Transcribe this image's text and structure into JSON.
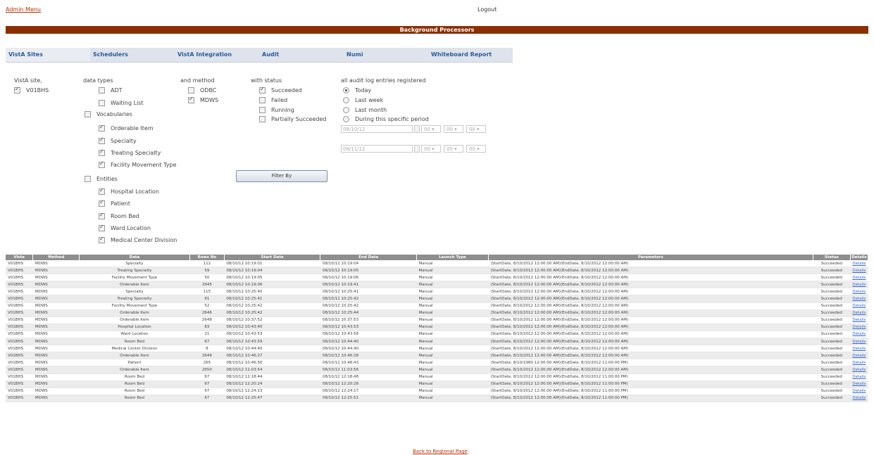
{
  "top": {
    "admin_menu": "Admin Menu",
    "logout": "Logout"
  },
  "banner": {
    "title": "Background Processors"
  },
  "tabs": [
    "VistA Sites",
    "Schedulers",
    "VistA Integration",
    "Audit",
    "Numi",
    "Whiteboard Report"
  ],
  "filters": {
    "site": {
      "heading": "VistA site,",
      "items": [
        {
          "label": "V01BHS",
          "checked": true
        }
      ]
    },
    "data_types": {
      "heading": "data types",
      "adt": "ADT",
      "waiting_list": "Waiting List",
      "vocabularies": "Vocabularies",
      "vocab_items": [
        "Orderable Item",
        "Specialty",
        "Treating Specialty",
        "Facility Movement Type"
      ],
      "entities": "Entities",
      "entity_items": [
        "Hospital Location",
        "Patient",
        "Room Bed",
        "Ward Location",
        "Medical Center Division"
      ]
    },
    "method": {
      "heading": "and method",
      "odbc": "ODBC",
      "mdws": "MDWS"
    },
    "status": {
      "heading": "with status",
      "items": [
        "Succeeded",
        "Failed",
        "Running",
        "Partially Succeeded"
      ]
    },
    "period": {
      "heading": "all audit log entries registered",
      "options": [
        "Today",
        "Last week",
        "Last month",
        "During this specific period"
      ],
      "from_date": "08/10/12",
      "to_date": "08/11/12",
      "time_placeholder": "00"
    },
    "filter_button": "Filter By"
  },
  "table": {
    "headers": [
      "Vista",
      "Method",
      "Data",
      "Rows No",
      "Start Date",
      "End Date",
      "Launch Type",
      "Parameters",
      "Status",
      "Details"
    ],
    "rows": [
      [
        "V01BHS",
        "MDWS",
        "Specialty",
        "112",
        "08/10/12 10:19:01",
        "08/10/12 10:19:04",
        "Manual",
        "(StartDate, 8/10/2012 12:00:00 AM)(EndDate, 8/10/2012 12:00:00 AM)",
        "Succeeded",
        "Details"
      ],
      [
        "V01BHS",
        "MDWS",
        "Treating Specialty",
        "59",
        "08/10/12 10:19:04",
        "08/10/12 10:19:05",
        "Manual",
        "(StartDate, 8/10/2012 12:00:00 AM)(EndDate, 8/10/2012 12:00:00 AM)",
        "Succeeded",
        "Details"
      ],
      [
        "V01BHS",
        "MDWS",
        "Facility Movement Type",
        "50",
        "08/10/12 10:19:05",
        "08/10/12 10:19:06",
        "Manual",
        "(StartDate, 8/10/2012 12:00:00 AM)(EndDate, 8/10/2012 12:00:00 AM)",
        "Succeeded",
        "Details"
      ],
      [
        "V01BHS",
        "MDWS",
        "Orderable Item",
        "2645",
        "08/10/12 10:19:06",
        "08/10/12 10:19:41",
        "Manual",
        "(StartDate, 8/10/2012 12:00:00 AM)(EndDate, 8/10/2012 12:00:00 AM)",
        "Succeeded",
        "Details"
      ],
      [
        "V01BHS",
        "MDWS",
        "Specialty",
        "115",
        "08/10/12 10:25:40",
        "08/10/12 10:25:41",
        "Manual",
        "(StartDate, 8/10/2012 12:00:00 AM)(EndDate, 8/10/2012 12:00:00 AM)",
        "Succeeded",
        "Details"
      ],
      [
        "V01BHS",
        "MDWS",
        "Treating Specialty",
        "61",
        "08/10/12 10:25:41",
        "08/10/12 10:25:42",
        "Manual",
        "(StartDate, 8/10/2012 12:00:00 AM)(EndDate, 8/10/2012 12:00:00 AM)",
        "Succeeded",
        "Details"
      ],
      [
        "V01BHS",
        "MDWS",
        "Facility Movement Type",
        "52",
        "08/10/12 10:25:42",
        "08/10/12 10:25:42",
        "Manual",
        "(StartDate, 8/10/2012 12:00:00 AM)(EndDate, 8/10/2012 12:00:00 AM)",
        "Succeeded",
        "Details"
      ],
      [
        "V01BHS",
        "MDWS",
        "Orderable Item",
        "2646",
        "08/10/12 10:25:42",
        "08/10/12 10:25:44",
        "Manual",
        "(StartDate, 8/10/2012 12:00:00 AM)(EndDate, 8/10/2012 12:00:00 AM)",
        "Succeeded",
        "Details"
      ],
      [
        "V01BHS",
        "MDWS",
        "Orderable Item",
        "2648",
        "08/10/12 10:37:52",
        "08/10/12 10:37:53",
        "Manual",
        "(StartDate, 8/10/2012 12:00:00 AM)(EndDate, 8/10/2012 12:00:00 AM)",
        "Succeeded",
        "Details"
      ],
      [
        "V01BHS",
        "MDWS",
        "Hospital Location",
        "83",
        "08/10/12 10:43:40",
        "08/10/12 10:43:53",
        "Manual",
        "(StartDate, 8/10/2012 12:00:00 AM)(EndDate, 8/10/2012 12:00:00 AM)",
        "Succeeded",
        "Details"
      ],
      [
        "V01BHS",
        "MDWS",
        "Ward Location",
        "21",
        "08/10/12 10:43:53",
        "08/10/12 10:43:58",
        "Manual",
        "(StartDate, 8/10/2012 12:00:00 AM)(EndDate, 8/10/2012 12:00:00 AM)",
        "Succeeded",
        "Details"
      ],
      [
        "V01BHS",
        "MDWS",
        "Room Bed",
        "67",
        "08/10/12 10:43:59",
        "08/10/12 10:44:40",
        "Manual",
        "(StartDate, 8/10/2012 12:00:00 AM)(EndDate, 8/10/2012 12:00:00 AM)",
        "Succeeded",
        "Details"
      ],
      [
        "V01BHS",
        "MDWS",
        "Medical Center Division",
        "8",
        "08/10/12 10:44:40",
        "08/10/12 10:44:40",
        "Manual",
        "(StartDate, 8/10/2012 12:00:00 AM)(EndDate, 8/10/2012 12:00:00 AM)",
        "Succeeded",
        "Details"
      ],
      [
        "V01BHS",
        "MDWS",
        "Orderable Item",
        "2649",
        "08/10/12 10:46:27",
        "08/10/12 10:46:28",
        "Manual",
        "(StartDate, 8/10/2012 12:00:00 AM)(EndDate, 8/10/2012 12:00:00 AM)",
        "Succeeded",
        "Details"
      ],
      [
        "V01BHS",
        "MDWS",
        "Patient",
        "265",
        "08/10/12 10:46:56",
        "08/10/12 10:48:43",
        "Manual",
        "(StartDate, 8/10/1980 12:00:00 AM)(EndDate, 8/10/2012 11:00:00 PM)",
        "Succeeded",
        "Details"
      ],
      [
        "V01BHS",
        "MDWS",
        "Orderable Item",
        "2650",
        "08/10/12 11:03:54",
        "08/10/12 11:03:56",
        "Manual",
        "(StartDate, 8/10/2012 12:00:00 AM)(EndDate, 8/10/2012 12:00:00 AM)",
        "Succeeded",
        "Details"
      ],
      [
        "V01BHS",
        "MDWS",
        "Room Bed",
        "67",
        "08/10/12 12:18:44",
        "08/10/12 12:18:48",
        "Manual",
        "(StartDate, 8/10/2012 12:00:00 AM)(EndDate, 8/10/2012 11:00:00 PM)",
        "Succeeded",
        "Details"
      ],
      [
        "V01BHS",
        "MDWS",
        "Room Bed",
        "67",
        "08/10/12 12:20:24",
        "08/10/12 12:20:28",
        "Manual",
        "(StartDate, 8/10/2012 12:00:00 AM)(EndDate, 8/10/2012 11:00:00 PM)",
        "Succeeded",
        "Details"
      ],
      [
        "V01BHS",
        "MDWS",
        "Room Bed",
        "67",
        "08/10/12 12:24:13",
        "08/10/12 12:24:17",
        "Manual",
        "(StartDate, 8/10/2012 12:00:00 AM)(EndDate, 8/10/2012 11:00:00 PM)",
        "Succeeded",
        "Details"
      ],
      [
        "V01BHS",
        "MDWS",
        "Room Bed",
        "67",
        "08/10/12 12:25:47",
        "08/10/12 12:25:51",
        "Manual",
        "(StartDate, 8/10/2012 12:00:00 AM)(EndDate, 8/10/2012 11:00:00 PM)",
        "Succeeded",
        "Details"
      ]
    ]
  },
  "footer": {
    "back_link": "Back to Regional Page",
    "separator": "|"
  }
}
